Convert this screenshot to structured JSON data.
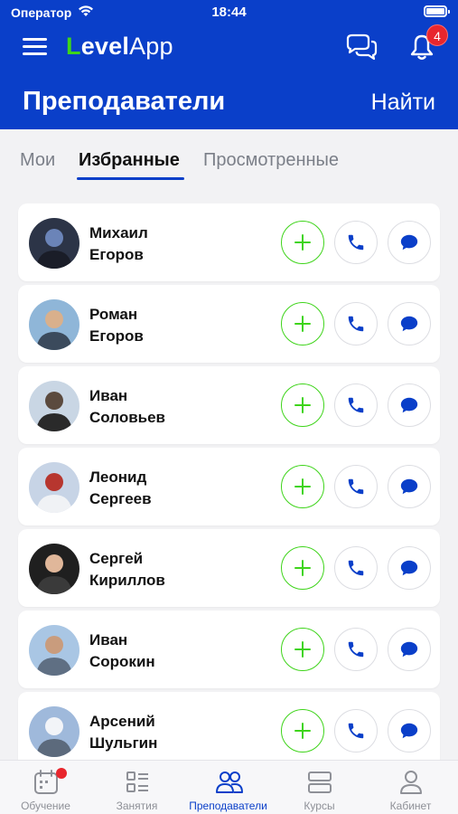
{
  "status_bar": {
    "carrier": "Оператор",
    "time": "18:44"
  },
  "header": {
    "logo_l": "L",
    "logo_level": "evel",
    "logo_app": "App",
    "notifications_count": "4",
    "title": "Преподаватели",
    "search_label": "Найти"
  },
  "tabs": [
    {
      "label": "Мои",
      "active": false
    },
    {
      "label": "Избранные",
      "active": true
    },
    {
      "label": "Просмотренные",
      "active": false
    }
  ],
  "teachers": [
    {
      "first": "Михаил",
      "last": "Егоров"
    },
    {
      "first": "Роман",
      "last": "Егоров"
    },
    {
      "first": "Иван",
      "last": "Соловьев"
    },
    {
      "first": "Леонид",
      "last": "Сергеев"
    },
    {
      "first": "Сергей",
      "last": "Кириллов"
    },
    {
      "first": "Иван",
      "last": "Сорокин"
    },
    {
      "first": "Арсений",
      "last": "Шульгин"
    }
  ],
  "bottom_nav": [
    {
      "label": "Обучение",
      "icon": "calendar-icon",
      "active": false
    },
    {
      "label": "Занятия",
      "icon": "list-icon",
      "active": false
    },
    {
      "label": "Преподаватели",
      "icon": "people-icon",
      "active": true
    },
    {
      "label": "Курсы",
      "icon": "stack-icon",
      "active": false
    },
    {
      "label": "Кабинет",
      "icon": "person-icon",
      "active": false
    }
  ],
  "colors": {
    "brand_blue": "#0a3fc9",
    "accent_green": "#3ed41a",
    "badge_red": "#e8262d"
  }
}
